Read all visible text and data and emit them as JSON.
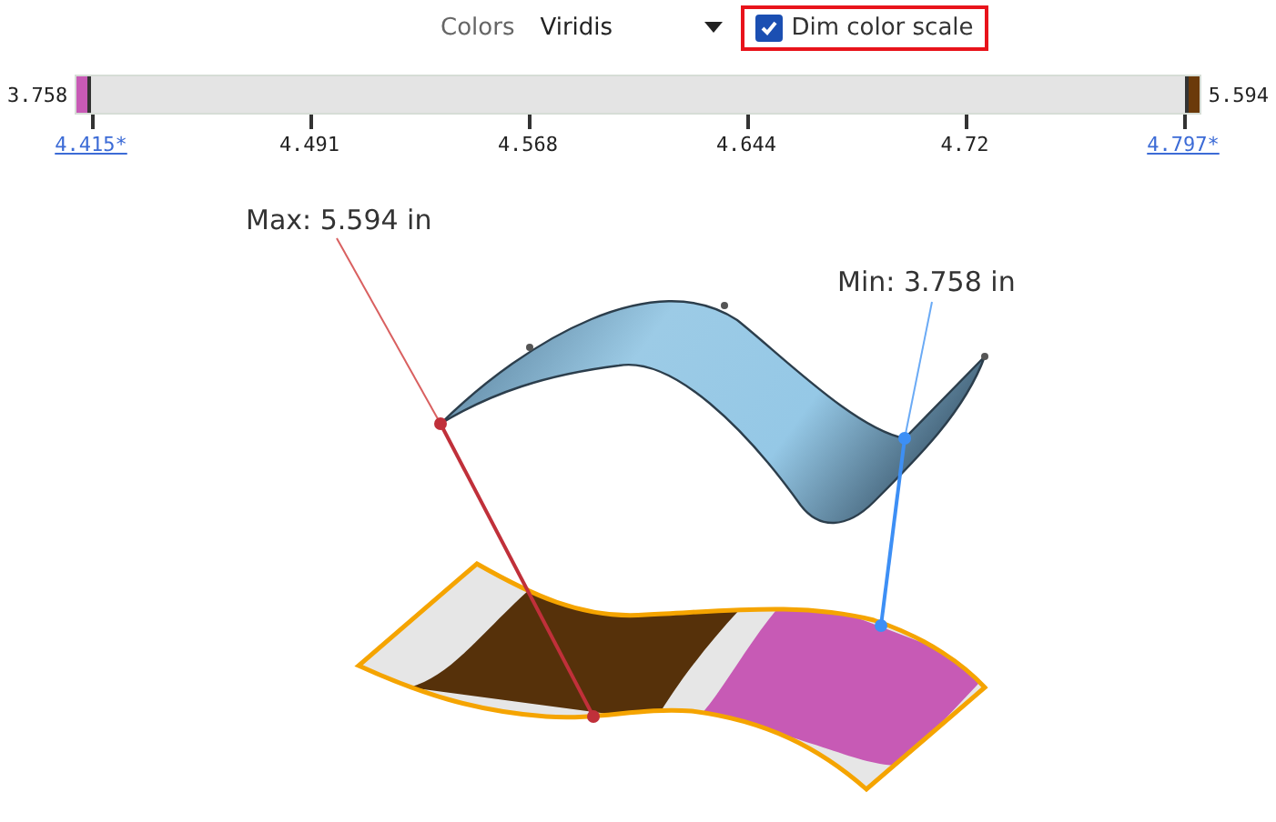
{
  "toolbar": {
    "colors_label": "Colors",
    "colormap": {
      "value": "Viridis"
    },
    "dim_checkbox": {
      "label": "Dim color scale",
      "checked": true,
      "highlighted": true
    }
  },
  "scale": {
    "min": "3.758",
    "max": "5.594",
    "ticks": [
      {
        "label": "4.415*",
        "kind": "link"
      },
      {
        "label": "4.491",
        "kind": "plain"
      },
      {
        "label": "4.568",
        "kind": "plain"
      },
      {
        "label": "4.644",
        "kind": "plain"
      },
      {
        "label": "4.72",
        "kind": "plain"
      },
      {
        "label": "4.797*",
        "kind": "link"
      }
    ]
  },
  "viewport": {
    "max_label": "Max: 5.594 in",
    "min_label": "Min: 3.758 in"
  }
}
